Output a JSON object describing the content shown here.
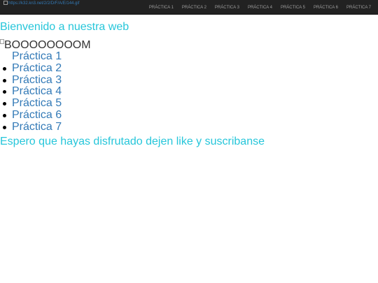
{
  "navbar": {
    "brand_alt": "https://k32.kn3.net/2/2/D/F/A/E/144.gif",
    "links": [
      "PRÁCTICA 1",
      "PRÁCTICA 2",
      "PRÁCTICA 3",
      "PRÁCTICA 4",
      "PRÁCTICA 5",
      "PRÁCTICA 6",
      "PRÁCTICA 7"
    ]
  },
  "main": {
    "heading": "Bienvenido a nuestra web",
    "image_alt": "BOOOOOOOOM",
    "practices": [
      "Práctica 1",
      "Práctica 2",
      "Práctica 3",
      "Práctica 4",
      "Práctica 5",
      "Práctica 6",
      "Práctica 7"
    ],
    "footer_text": "Espero que hayas disfrutado dejen like y suscribanse"
  },
  "colors": {
    "navbar_bg": "#222222",
    "nav_link": "#9d9d9d",
    "link": "#337ab7",
    "accent": "#26c6da"
  }
}
